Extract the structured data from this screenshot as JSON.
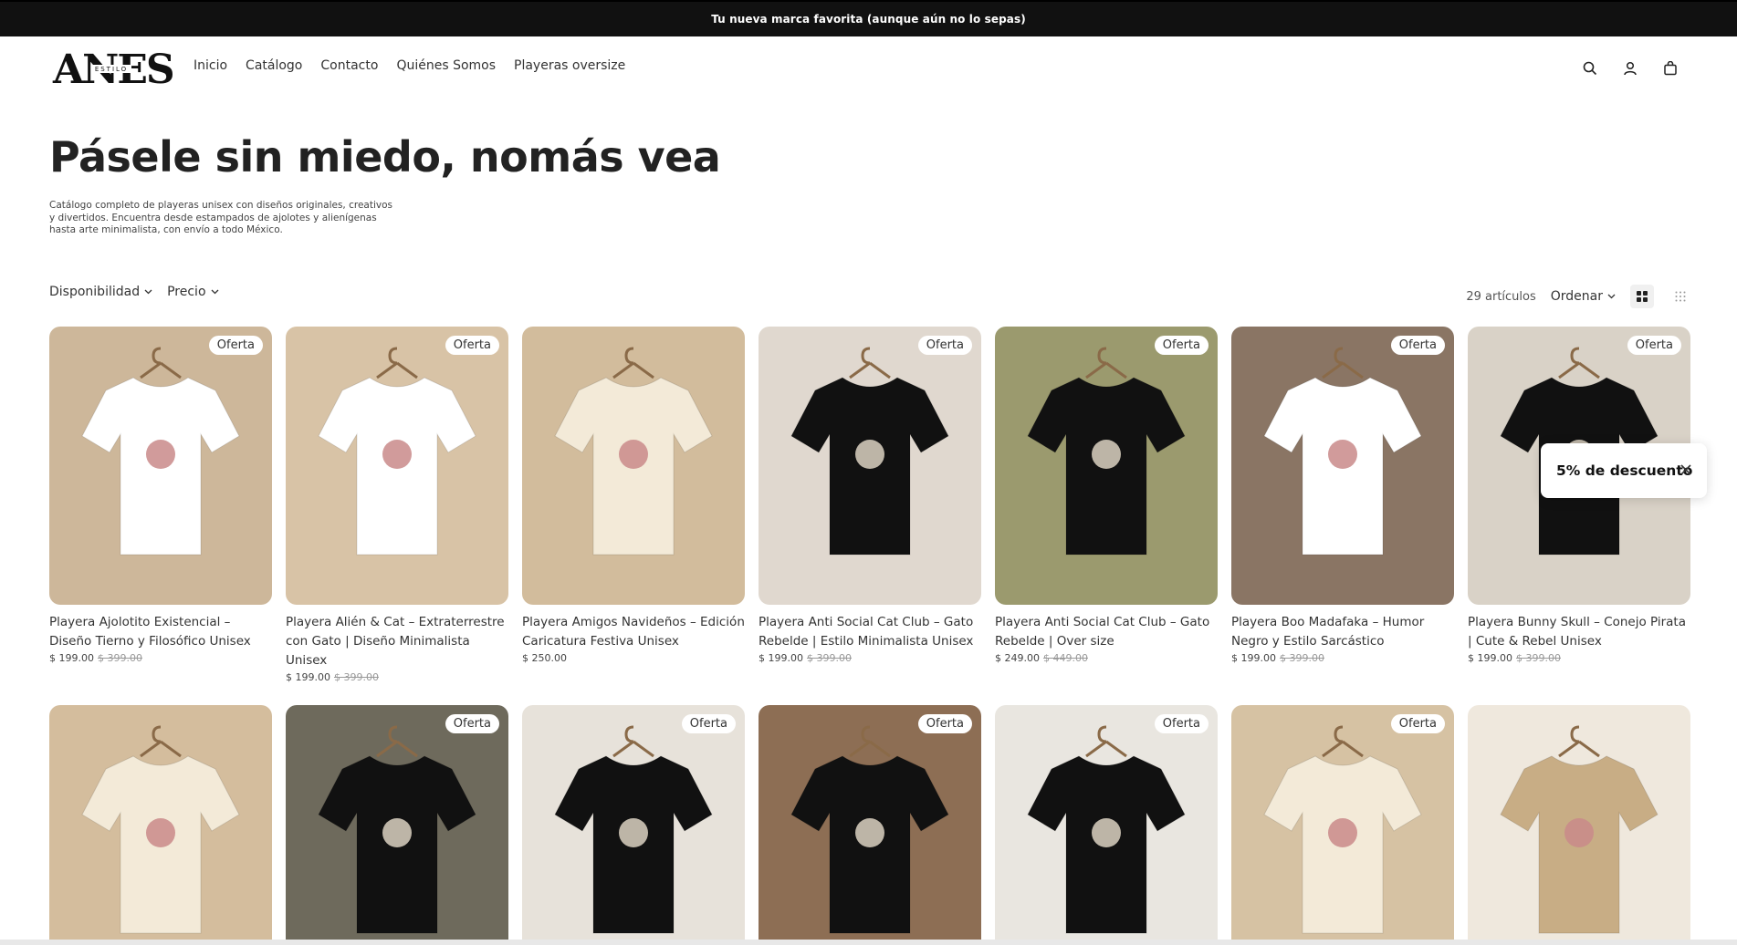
{
  "announcement": {
    "text": "Tu nueva marca favorita (aunque aún no lo sepas)"
  },
  "header": {
    "logo_text": "ANES",
    "logo_subtext": "ESTILO",
    "nav": [
      "Inicio",
      "Catálogo",
      "Contacto",
      "Quiénes Somos",
      "Playeras oversize"
    ],
    "icons": [
      "search-icon",
      "account-icon",
      "cart-icon"
    ]
  },
  "hero": {
    "title": "Pásele sin miedo, nomás vea",
    "description": "Catálogo completo de playeras unisex con diseños originales, creativos y divertidos. Encuentra desde estampados de ajolotes y alienígenas hasta arte minimalista, con envío a todo México."
  },
  "toolbar": {
    "filters": [
      "Disponibilidad",
      "Precio"
    ],
    "count": "29 artículos",
    "sort_label": "Ordenar"
  },
  "products": [
    {
      "title": "Playera Ajolotito Existencial – Diseño Tierno y Filosófico Unisex",
      "price": "$ 199.00",
      "old_price": "$ 399.00",
      "badge": "Oferta",
      "bg": "#cdb79a",
      "shirt": "#ffffff"
    },
    {
      "title": "Playera Alién & Cat – Extraterrestre con Gato | Diseño Minimalista Unisex",
      "price": "$ 199.00",
      "old_price": "$ 399.00",
      "badge": "Oferta",
      "bg": "#d8c3a6",
      "shirt": "#ffffff"
    },
    {
      "title": "Playera Amigos Navideños – Edición Caricatura Festiva Unisex",
      "price": "$ 250.00",
      "old_price": "",
      "badge": "",
      "bg": "#d2bc9c",
      "shirt": "#f3ead8"
    },
    {
      "title": "Playera Anti Social Cat Club – Gato Rebelde | Estilo Minimalista Unisex",
      "price": "$ 199.00",
      "old_price": "$ 399.00",
      "badge": "Oferta",
      "bg": "#e0d8cf",
      "shirt": "#111111"
    },
    {
      "title": "Playera Anti Social Cat Club – Gato Rebelde | Over size",
      "price": "$ 249.00",
      "old_price": "$ 449.00",
      "badge": "Oferta",
      "bg": "#9b9a6e",
      "shirt": "#111111"
    },
    {
      "title": "Playera Boo Madafaka – Humor Negro y Estilo Sarcástico",
      "price": "$ 199.00",
      "old_price": "$ 399.00",
      "badge": "Oferta",
      "bg": "#8a7564",
      "shirt": "#ffffff"
    },
    {
      "title": "Playera Bunny Skull – Conejo Pirata | Cute & Rebel Unisex",
      "price": "$ 199.00",
      "old_price": "$ 399.00",
      "badge": "Oferta",
      "bg": "#d9d2c7",
      "shirt": "#111111"
    },
    {
      "title": "",
      "price": "",
      "old_price": "",
      "badge": "",
      "bg": "#d4bd9d",
      "shirt": "#f3ead8"
    },
    {
      "title": "",
      "price": "",
      "old_price": "",
      "badge": "Oferta",
      "bg": "#6e6a5c",
      "shirt": "#111111"
    },
    {
      "title": "",
      "price": "",
      "old_price": "",
      "badge": "Oferta",
      "bg": "#e7e2da",
      "shirt": "#111111"
    },
    {
      "title": "",
      "price": "",
      "old_price": "",
      "badge": "Oferta",
      "bg": "#8d6e54",
      "shirt": "#111111"
    },
    {
      "title": "",
      "price": "",
      "old_price": "",
      "badge": "Oferta",
      "bg": "#e9e6e0",
      "shirt": "#111111"
    },
    {
      "title": "",
      "price": "",
      "old_price": "",
      "badge": "Oferta",
      "bg": "#d6c2a3",
      "shirt": "#f3ead8"
    },
    {
      "title": "",
      "price": "",
      "old_price": "",
      "badge": "",
      "bg": "#efe8dd",
      "shirt": "#c8ad85"
    }
  ],
  "popup": {
    "text": "5% de descuento"
  }
}
